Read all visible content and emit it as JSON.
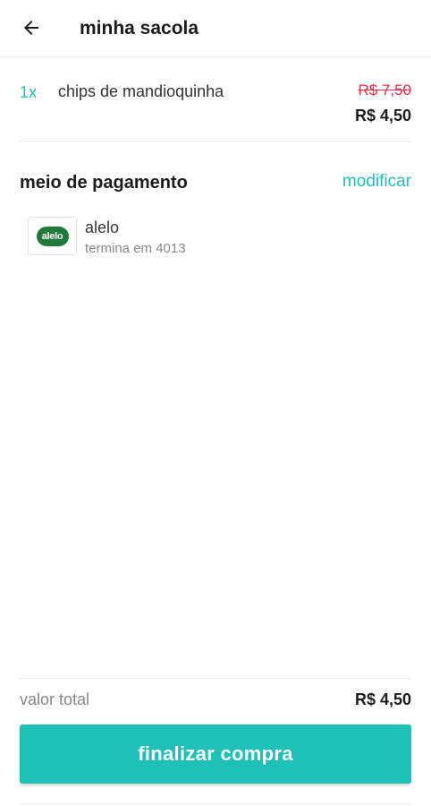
{
  "header": {
    "back_icon": "arrow-left-icon",
    "title": "minha sacola"
  },
  "cart": {
    "items": [
      {
        "quantity": "1x",
        "name": "chips de mandioquinha",
        "original_price": "R$ 7,50",
        "price": "R$ 4,50"
      }
    ]
  },
  "payment": {
    "title": "meio de pagamento",
    "modify_label": "modificar",
    "card": {
      "logo_text": "alelo",
      "name": "alelo",
      "detail": "termina em 4013"
    }
  },
  "summary": {
    "total_label": "valor total",
    "total_value": "R$ 4,50",
    "checkout_label": "finalizar compra"
  },
  "colors": {
    "accent": "#1fc0b7",
    "discount_red": "#ef2b48",
    "alelo_green": "#1f7a3a"
  }
}
